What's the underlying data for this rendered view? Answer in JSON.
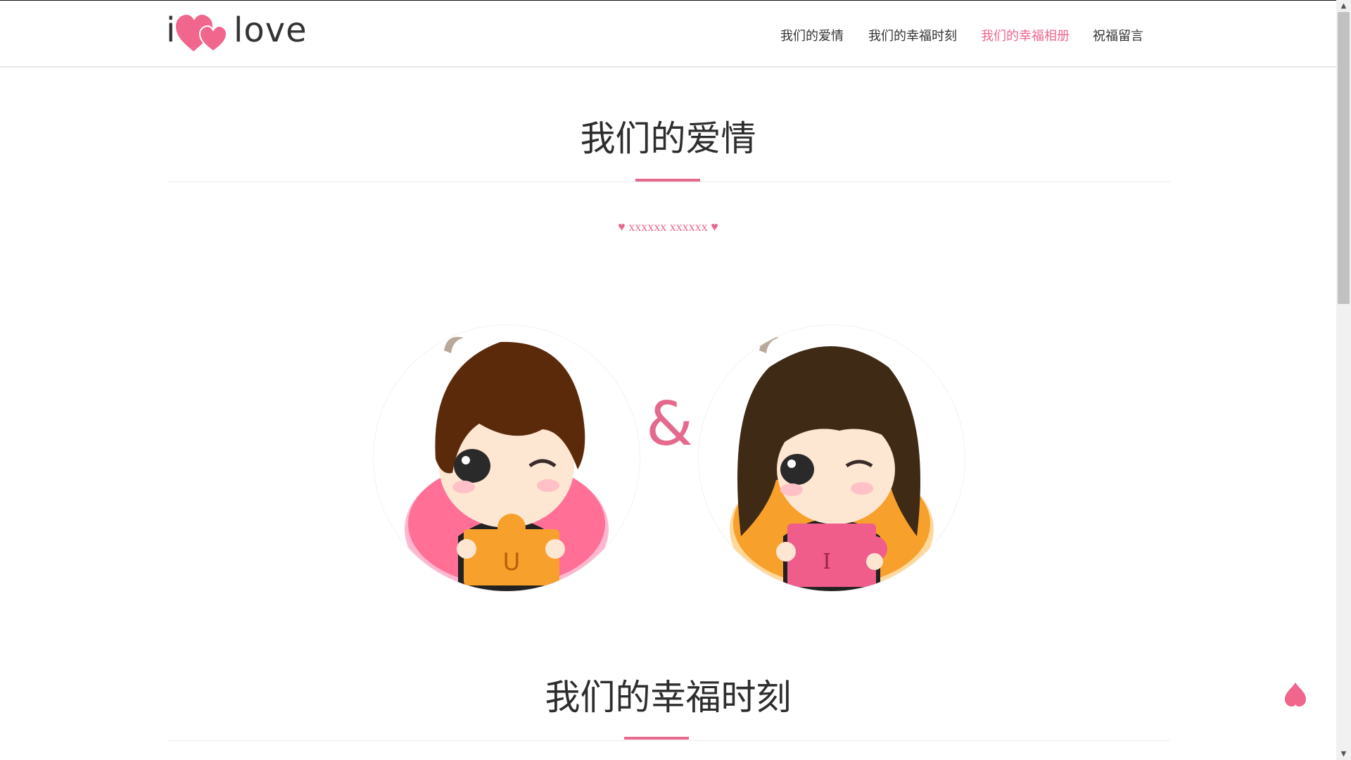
{
  "logo": {
    "letter": "i",
    "word": "love"
  },
  "nav": {
    "items": [
      {
        "label": "我们的爱情"
      },
      {
        "label": "我们的幸福时刻"
      },
      {
        "label": "我们的幸福相册"
      },
      {
        "label": "祝福留言"
      }
    ],
    "active_index": 2
  },
  "section1": {
    "title": "我们的爱情",
    "subtitle": "♥ xxxxxx xxxxxx ♥",
    "ampersand": "&",
    "boy_letter": "U",
    "girl_letter": "I"
  },
  "section2": {
    "title": "我们的幸福时刻"
  },
  "colors": {
    "accent": "#e5698c",
    "text": "#2d2d2d",
    "boy_bg": "#ff6f96",
    "girl_bg": "#f8a02c"
  },
  "icons": {
    "back_to_top": "heart-up-icon"
  }
}
